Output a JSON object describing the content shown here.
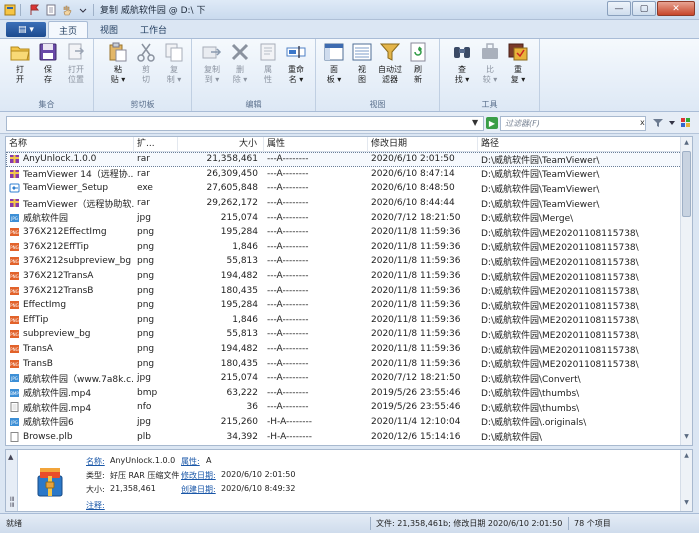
{
  "titlebar": {
    "title": "复制 威航软件园 @ D:\\ 下",
    "buttons": [
      "—",
      "▢",
      "✕"
    ]
  },
  "ribbon_tabs": {
    "app_menu": "▤ ▾",
    "tabs": [
      "主页",
      "视图",
      "工作台"
    ],
    "active": "主页"
  },
  "ribbon": {
    "groups": [
      {
        "label": "集合",
        "buttons": [
          {
            "label": "打\n开",
            "icon": "folder-open-icon"
          },
          {
            "label": "保\n存",
            "icon": "save-icon"
          },
          {
            "label": "打开\n位置",
            "icon": "open-location-icon"
          }
        ]
      },
      {
        "label": "剪切板",
        "buttons": [
          {
            "label": "粘\n贴 ▾",
            "icon": "paste-icon"
          },
          {
            "label": "剪\n切",
            "icon": "cut-icon"
          },
          {
            "label": "复\n制 ▾",
            "icon": "copy-icon"
          }
        ]
      },
      {
        "label": "编辑",
        "buttons": [
          {
            "label": "复制\n到 ▾",
            "icon": "copy-to-icon"
          },
          {
            "label": "删\n除 ▾",
            "icon": "delete-icon"
          },
          {
            "label": "属\n性",
            "icon": "properties-icon"
          },
          {
            "label": "重命\n名 ▾",
            "icon": "rename-icon"
          }
        ]
      },
      {
        "label": "视图",
        "buttons": [
          {
            "label": "面\n板 ▾",
            "icon": "panel-icon"
          },
          {
            "label": "视\n图",
            "icon": "view-icon"
          },
          {
            "label": "自动过\n滤器",
            "icon": "auto-filter-icon"
          },
          {
            "label": "刷\n新",
            "icon": "refresh-icon"
          }
        ]
      },
      {
        "label": "工具",
        "buttons": [
          {
            "label": "查\n找 ▾",
            "icon": "find-icon"
          },
          {
            "label": "比\n较 ▾",
            "icon": "compare-icon"
          },
          {
            "label": "重\n复 ▾",
            "icon": "duplicate-icon"
          }
        ]
      }
    ]
  },
  "addressbar": {
    "path": "",
    "filter_placeholder": "过滤器(F)"
  },
  "filelist": {
    "columns": [
      "名称",
      "扩...",
      "大小",
      "属性",
      "修改日期",
      "路径"
    ],
    "rows": [
      {
        "name": "AnyUnlock.1.0.0",
        "ext": "rar",
        "size": "21,358,461",
        "attr": "---A--------",
        "date": "2020/6/10 2:01:50",
        "path": "D:\\威航软件园\\TeamViewer\\",
        "icon": "rar",
        "selected": true
      },
      {
        "name": "TeamViewer 14（远程协...",
        "ext": "rar",
        "size": "26,309,450",
        "attr": "---A--------",
        "date": "2020/6/10 8:47:14",
        "path": "D:\\威航软件园\\TeamViewer\\",
        "icon": "rar"
      },
      {
        "name": "TeamViewer_Setup",
        "ext": "exe",
        "size": "27,605,848",
        "attr": "---A--------",
        "date": "2020/6/10 8:48:50",
        "path": "D:\\威航软件园\\TeamViewer\\",
        "icon": "exe"
      },
      {
        "name": "TeamViewer（远程协助软...",
        "ext": "rar",
        "size": "29,262,172",
        "attr": "---A--------",
        "date": "2020/6/10 8:44:44",
        "path": "D:\\威航软件园\\TeamViewer\\",
        "icon": "rar"
      },
      {
        "name": "威航软件园",
        "ext": "jpg",
        "size": "215,074",
        "attr": "---A--------",
        "date": "2020/7/12 18:21:50",
        "path": "D:\\威航软件园\\Merge\\",
        "icon": "jpg"
      },
      {
        "name": "376X212EffectImg",
        "ext": "png",
        "size": "195,284",
        "attr": "---A--------",
        "date": "2020/11/8 11:59:36",
        "path": "D:\\威航软件园\\ME20201108115738\\",
        "icon": "png"
      },
      {
        "name": "376X212EffTip",
        "ext": "png",
        "size": "1,846",
        "attr": "---A--------",
        "date": "2020/11/8 11:59:36",
        "path": "D:\\威航软件园\\ME20201108115738\\",
        "icon": "png"
      },
      {
        "name": "376X212subpreview_bg",
        "ext": "png",
        "size": "55,813",
        "attr": "---A--------",
        "date": "2020/11/8 11:59:36",
        "path": "D:\\威航软件园\\ME20201108115738\\",
        "icon": "png"
      },
      {
        "name": "376X212TransA",
        "ext": "png",
        "size": "194,482",
        "attr": "---A--------",
        "date": "2020/11/8 11:59:36",
        "path": "D:\\威航软件园\\ME20201108115738\\",
        "icon": "png"
      },
      {
        "name": "376X212TransB",
        "ext": "png",
        "size": "180,435",
        "attr": "---A--------",
        "date": "2020/11/8 11:59:36",
        "path": "D:\\威航软件园\\ME20201108115738\\",
        "icon": "png"
      },
      {
        "name": "EffectImg",
        "ext": "png",
        "size": "195,284",
        "attr": "---A--------",
        "date": "2020/11/8 11:59:36",
        "path": "D:\\威航软件园\\ME20201108115738\\",
        "icon": "png"
      },
      {
        "name": "EffTip",
        "ext": "png",
        "size": "1,846",
        "attr": "---A--------",
        "date": "2020/11/8 11:59:36",
        "path": "D:\\威航软件园\\ME20201108115738\\",
        "icon": "png"
      },
      {
        "name": "subpreview_bg",
        "ext": "png",
        "size": "55,813",
        "attr": "---A--------",
        "date": "2020/11/8 11:59:36",
        "path": "D:\\威航软件园\\ME20201108115738\\",
        "icon": "png"
      },
      {
        "name": "TransA",
        "ext": "png",
        "size": "194,482",
        "attr": "---A--------",
        "date": "2020/11/8 11:59:36",
        "path": "D:\\威航软件园\\ME20201108115738\\",
        "icon": "png"
      },
      {
        "name": "TransB",
        "ext": "png",
        "size": "180,435",
        "attr": "---A--------",
        "date": "2020/11/8 11:59:36",
        "path": "D:\\威航软件园\\ME20201108115738\\",
        "icon": "png"
      },
      {
        "name": "威航软件园（www.7a8k.c...",
        "ext": "jpg",
        "size": "215,074",
        "attr": "---A--------",
        "date": "2020/7/12 18:21:50",
        "path": "D:\\威航软件园\\Convert\\",
        "icon": "jpg"
      },
      {
        "name": "威航软件园.mp4",
        "ext": "bmp",
        "size": "63,222",
        "attr": "---A--------",
        "date": "2019/5/26 23:55:46",
        "path": "D:\\威航软件园\\thumbs\\",
        "icon": "bmp"
      },
      {
        "name": "威航软件园.mp4",
        "ext": "nfo",
        "size": "36",
        "attr": "---A--------",
        "date": "2019/5/26 23:55:46",
        "path": "D:\\威航软件园\\thumbs\\",
        "icon": "nfo"
      },
      {
        "name": "威航软件园6",
        "ext": "jpg",
        "size": "215,260",
        "attr": "-H-A--------",
        "date": "2020/11/4 12:10:04",
        "path": "D:\\威航软件园\\.originals\\",
        "icon": "jpg"
      },
      {
        "name": "Browse.plb",
        "ext": "plb",
        "size": "34,392",
        "attr": "-H-A--------",
        "date": "2020/12/6 15:14:16",
        "path": "D:\\威航软件园\\",
        "icon": "plb"
      }
    ]
  },
  "infopane": {
    "name_key": "名称:",
    "name_val": "AnyUnlock.1.0.0",
    "attr_key": "属性:",
    "attr_val": "A",
    "type_key": "类型:",
    "type_val": "好压 RAR 压缩文件",
    "mdate_key": "修改日期:",
    "mdate_val": "2020/6/10 2:01:50",
    "size_key": "大小:",
    "size_val": "21,358,461",
    "cdate_key": "创建日期:",
    "cdate_val": "2020/6/10 8:49:32",
    "comment_key": "注释:"
  },
  "statusbar": {
    "left": "就绪",
    "file_info": "文件: 21,358,461b; 修改日期 2020/6/10 2:01:50",
    "count": "78 个项目"
  },
  "colors": {
    "rar": "#8a3aa8",
    "exe": "#2f7fd0",
    "jpg": "#3d8fd6",
    "png": "#e2622a",
    "bmp": "#3d8fd6",
    "nfo": "#d7d7d7",
    "plb": "#e8e8e8"
  }
}
